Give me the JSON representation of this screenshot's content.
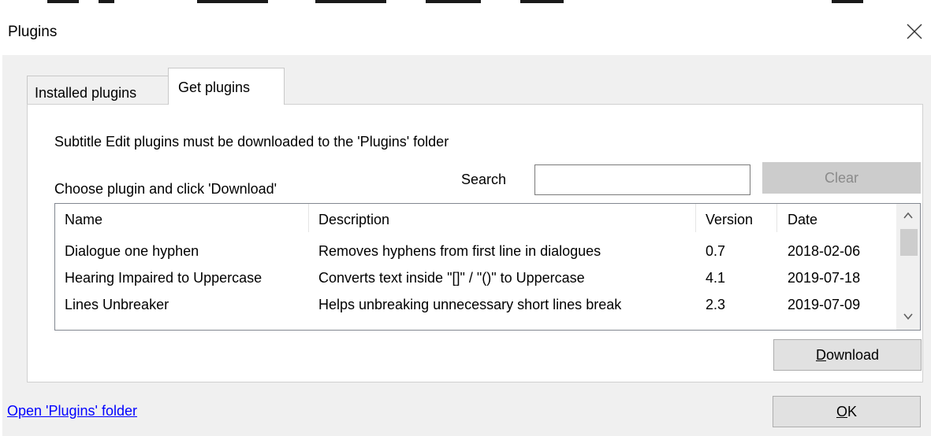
{
  "window": {
    "title": "Plugins"
  },
  "tabs": [
    {
      "label": "Installed plugins",
      "selected": false
    },
    {
      "label": "Get plugins",
      "selected": true
    }
  ],
  "panel": {
    "info_text": "Subtitle Edit plugins must be downloaded to the 'Plugins' folder",
    "choose_text": "Choose plugin and click 'Download'",
    "search": {
      "label": "Search",
      "value": "",
      "placeholder": ""
    },
    "clear_label": "Clear",
    "download_label": "Download",
    "download_mnemonic": "D",
    "download_rest": "ownload"
  },
  "table": {
    "columns": [
      "Name",
      "Description",
      "Version",
      "Date"
    ],
    "rows": [
      {
        "name": "Dialogue one hyphen",
        "description": "Removes hyphens from first line in dialogues",
        "version": "0.7",
        "date": "2018-02-06"
      },
      {
        "name": "Hearing Impaired to Uppercase",
        "description": "Converts text inside \"[]\" / \"()\" to Uppercase",
        "version": "4.1",
        "date": "2019-07-18"
      },
      {
        "name": "Lines Unbreaker",
        "description": "Helps unbreaking unnecessary short lines break",
        "version": "2.3",
        "date": "2019-07-09"
      }
    ]
  },
  "footer": {
    "folder_link": "Open 'Plugins' folder",
    "ok_label": "OK",
    "ok_mnemonic": "O",
    "ok_rest": "K"
  },
  "colors": {
    "link": "#0000ff",
    "button_face": "#e1e1e1",
    "disabled_button": "#cccccc"
  },
  "icons": [
    "close-icon",
    "scroll-up-icon",
    "scroll-down-icon"
  ]
}
